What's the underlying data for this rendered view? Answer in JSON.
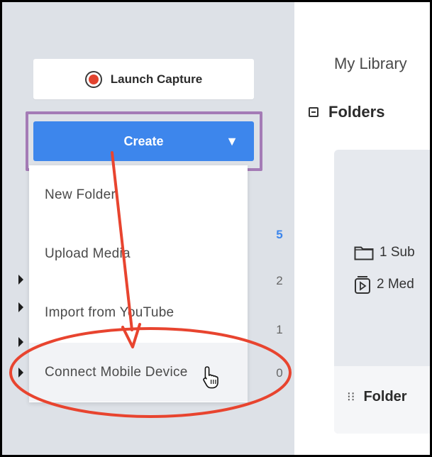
{
  "sidebar": {
    "launch_capture": {
      "label": "Launch Capture"
    },
    "create": {
      "label": "Create",
      "caret": "▼"
    },
    "menu": [
      {
        "label": "New Folder"
      },
      {
        "label": "Upload Media"
      },
      {
        "label": "Import from YouTube"
      },
      {
        "label": "Connect Mobile Device"
      }
    ],
    "counts": [
      "5",
      "2",
      "1",
      "0"
    ]
  },
  "main": {
    "breadcrumb": "My Library",
    "folders_title": "Folders",
    "card": {
      "subfolders": "1 Sub",
      "media": "2 Med",
      "footer_label": "Folder"
    }
  },
  "colors": {
    "primary": "#3d86ec",
    "annotation": "#e8442f",
    "highlight_box": "#a47bb6",
    "record": "#e2432f"
  },
  "icons": {
    "drag": "⁝⁝"
  }
}
